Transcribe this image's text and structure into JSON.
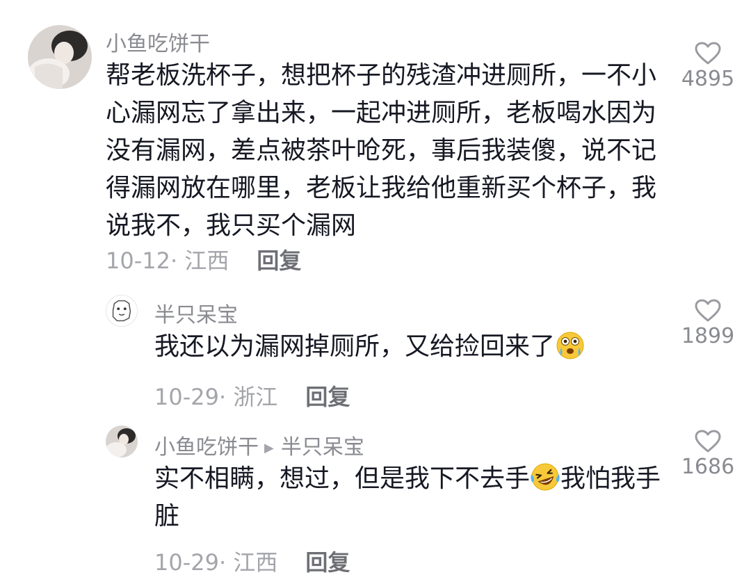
{
  "comments": [
    {
      "username": "小鱼吃饼干",
      "text": "帮老板洗杯子，想把杯子的残渣冲进厕所，一不小心漏网忘了拿出来，一起冲进厕所，老板喝水因为没有漏网，差点被茶叶呛死，事后我装傻，说不记得漏网放在哪里，老板让我给他重新买个杯子，我说我不，我只买个漏网",
      "meta": "10-12· 江西",
      "reply_label": "回复",
      "likes": "4895",
      "like_icon": "heart-outline-icon"
    },
    {
      "username": "半只呆宝",
      "text_before": "我还以为漏网掉厕所，又给捡回来了",
      "emoji": "wow-tears-emoji-icon",
      "meta": "10-29· 浙江",
      "reply_label": "回复",
      "likes": "1899",
      "like_icon": "heart-outline-icon"
    },
    {
      "username": "小鱼吃饼干",
      "reply_to_icon": "play-triangle-icon",
      "reply_to": "半只呆宝",
      "text_before": "实不相瞒，想过，但是我下不去手",
      "emoji": "laugh-tears-emoji-icon",
      "text_after": "我怕我手脏",
      "meta": "10-29· 江西",
      "reply_label": "回复",
      "likes": "1686",
      "like_icon": "heart-outline-icon"
    }
  ],
  "colors": {
    "username": "#8a8b91",
    "text": "#161823",
    "meta": "#a4a5aa",
    "reply": "#6e6f75"
  }
}
